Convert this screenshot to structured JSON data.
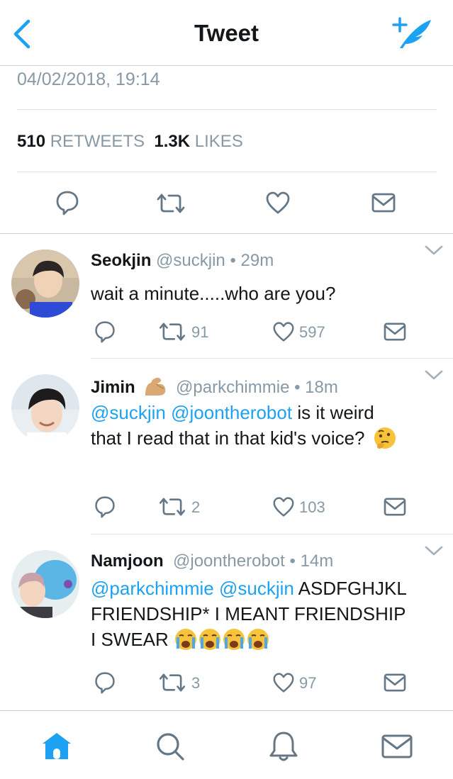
{
  "header": {
    "title": "Tweet",
    "back_icon": "chevron-left-icon",
    "compose_icon": "compose-tweet-icon"
  },
  "tweet": {
    "timestamp": "04/02/2018, 19:14",
    "retweet_count": "510",
    "retweet_label": "RETWEETS",
    "like_count": "1.3K",
    "like_label": "LIKES"
  },
  "replies": [
    {
      "name": "Seokjin",
      "handle": "@suckjin",
      "time": "• 29m",
      "text": "wait a minute.....who are you?",
      "retweets": "91",
      "likes": "597"
    },
    {
      "name": "Jimin",
      "handle": "@parkchimmie",
      "time": "• 18m",
      "mention_1": "@suckjin",
      "mention_2": "@joontherobot",
      "text_1": "is it weird",
      "text_2": "that I read that in that kid's voice?",
      "retweets": "2",
      "likes": "103"
    },
    {
      "name": "Namjoon",
      "handle": "@joontherobot",
      "time": "• 14m",
      "mention_1": "@parkchimmie",
      "mention_2": "@suckjin",
      "text_1": "ASDFGHJKL",
      "text_2": "FRIENDSHIP* I MEANT FRIENDSHIP",
      "text_3": "I SWEAR",
      "retweets": "3",
      "likes": "97"
    }
  ],
  "colors": {
    "accent": "#1da1f2",
    "secondary_text": "#8899a6",
    "icon": "#657786",
    "divider": "#dfe5ea"
  },
  "tabbar": {
    "items": [
      "home-icon",
      "search-icon",
      "notifications-icon",
      "messages-icon"
    ],
    "active": "home-icon"
  }
}
